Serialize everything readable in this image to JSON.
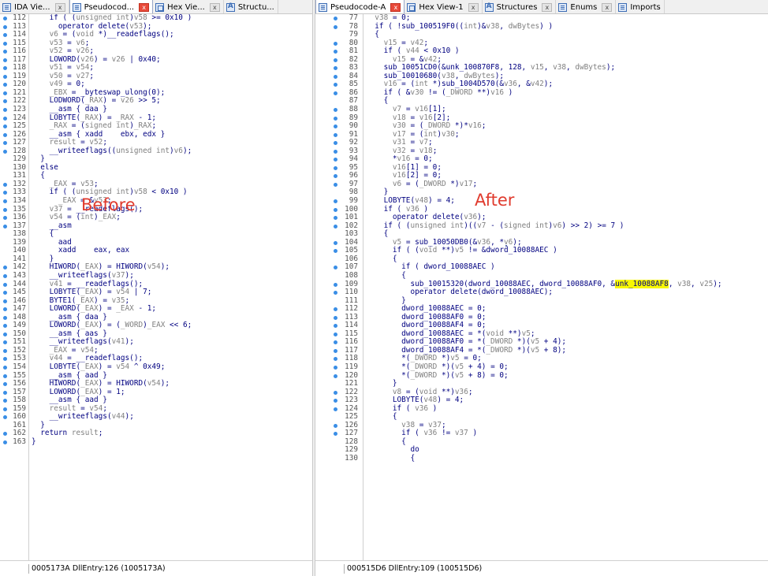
{
  "left": {
    "tabs": [
      {
        "label": "IDA Vie...",
        "icon": "ida-view-icon",
        "close": "x"
      },
      {
        "label": "Pseudocod...",
        "icon": "pseudocode-icon",
        "close": "x"
      },
      {
        "label": "Hex Vie...",
        "icon": "hex-view-icon",
        "close": "x"
      },
      {
        "label": "Structu...",
        "icon": "structures-icon",
        "close": ""
      }
    ],
    "status": "0005173A  DllEntry:126 (1005173A)"
  },
  "right": {
    "tabs": [
      {
        "label": "Pseudocode-A",
        "icon": "pseudocode-icon",
        "close": "x"
      },
      {
        "label": "Hex View-1",
        "icon": "hex-view-icon",
        "close": "x"
      },
      {
        "label": "Structures",
        "icon": "structures-icon",
        "close": "x"
      },
      {
        "label": "Enums",
        "icon": "enums-icon",
        "close": "x"
      },
      {
        "label": "Imports",
        "icon": "imports-icon",
        "close": ""
      }
    ],
    "status": "000515D6  DllEntry:109 (100515D6)"
  },
  "annotations": {
    "before": "Before",
    "after": "After",
    "color": "#e03b2e"
  },
  "highlight_color": "#f8f800",
  "accent_color": "#3a8ee6",
  "left_lines": [
    {
      "n": "112",
      "dot": true,
      "t": "    if ( (unsigned int)v58 >= 0x10 )"
    },
    {
      "n": "113",
      "dot": true,
      "t": "      operator delete(v53);"
    },
    {
      "n": "114",
      "dot": true,
      "t": "    v6 = (void *)__readeflags();"
    },
    {
      "n": "115",
      "dot": true,
      "t": "    v53 = v6;"
    },
    {
      "n": "116",
      "dot": true,
      "t": "    v52 = v26;"
    },
    {
      "n": "117",
      "dot": true,
      "t": "    LOWORD(v26) = v26 | 0x40;"
    },
    {
      "n": "118",
      "dot": true,
      "t": "    v51 = v54;"
    },
    {
      "n": "119",
      "dot": true,
      "t": "    v50 = v27;"
    },
    {
      "n": "120",
      "dot": true,
      "t": "    v49 = 0;"
    },
    {
      "n": "121",
      "dot": true,
      "t": "    _EBX = _byteswap_ulong(0);"
    },
    {
      "n": "122",
      "dot": true,
      "t": "    LODWORD(_RAX) = v26 >> 5;"
    },
    {
      "n": "123",
      "dot": true,
      "t": "    __asm { daa }"
    },
    {
      "n": "124",
      "dot": true,
      "t": "    LOBYTE(_RAX) = _RAX - 1;"
    },
    {
      "n": "125",
      "dot": true,
      "t": "    _RAX = (signed int)_RAX;"
    },
    {
      "n": "126",
      "dot": true,
      "t": "    __asm { xadd    ebx, edx }"
    },
    {
      "n": "127",
      "dot": true,
      "t": "    result = v52;"
    },
    {
      "n": "128",
      "dot": true,
      "t": "    __writeeflags((unsigned int)v6);"
    },
    {
      "n": "129",
      "dot": false,
      "t": "  }"
    },
    {
      "n": "130",
      "dot": false,
      "t": "  else"
    },
    {
      "n": "131",
      "dot": false,
      "t": "  {"
    },
    {
      "n": "132",
      "dot": true,
      "t": "    _EAX = v53;"
    },
    {
      "n": "133",
      "dot": true,
      "t": "    if ( (unsigned int)v58 < 0x10 )"
    },
    {
      "n": "134",
      "dot": true,
      "t": "      _EAX = &v53;"
    },
    {
      "n": "135",
      "dot": true,
      "t": "    v37 = __readeflags();"
    },
    {
      "n": "136",
      "dot": true,
      "t": "    v54 = (int)_EAX;"
    },
    {
      "n": "137",
      "dot": true,
      "t": "    __asm"
    },
    {
      "n": "138",
      "dot": false,
      "t": "    {"
    },
    {
      "n": "139",
      "dot": false,
      "t": "      aad"
    },
    {
      "n": "140",
      "dot": false,
      "t": "      xadd    eax, eax"
    },
    {
      "n": "141",
      "dot": false,
      "t": "    }"
    },
    {
      "n": "142",
      "dot": true,
      "t": "    HIWORD(_EAX) = HIWORD(v54);"
    },
    {
      "n": "143",
      "dot": true,
      "t": "    __writeeflags(v37);"
    },
    {
      "n": "144",
      "dot": true,
      "t": "    v41 = __readeflags();"
    },
    {
      "n": "145",
      "dot": true,
      "t": "    LOBYTE(_EAX) = v54 | 7;"
    },
    {
      "n": "146",
      "dot": true,
      "t": "    BYTE1(_EAX) = v35;"
    },
    {
      "n": "147",
      "dot": true,
      "t": "    LOWORD(_EAX) = _EAX - 1;"
    },
    {
      "n": "148",
      "dot": true,
      "t": "    __asm { daa }"
    },
    {
      "n": "149",
      "dot": true,
      "t": "    LOWORD(_EAX) = (_WORD)_EAX << 6;"
    },
    {
      "n": "150",
      "dot": true,
      "t": "    __asm { aas }"
    },
    {
      "n": "151",
      "dot": true,
      "t": "    __writeeflags(v41);"
    },
    {
      "n": "152",
      "dot": true,
      "t": "    _EAX = v54;"
    },
    {
      "n": "153",
      "dot": true,
      "t": "    v44 = __readeflags();"
    },
    {
      "n": "154",
      "dot": true,
      "t": "    LOBYTE(_EAX) = v54 ^ 0x49;"
    },
    {
      "n": "155",
      "dot": true,
      "t": "    __asm { aad }"
    },
    {
      "n": "156",
      "dot": true,
      "t": "    HIWORD(_EAX) = HIWORD(v54);"
    },
    {
      "n": "157",
      "dot": true,
      "t": "    LOWORD(_EAX) = 1;"
    },
    {
      "n": "158",
      "dot": true,
      "t": "    __asm { aad }"
    },
    {
      "n": "159",
      "dot": true,
      "t": "    result = v54;"
    },
    {
      "n": "160",
      "dot": true,
      "t": "    __writeeflags(v44);"
    },
    {
      "n": "161",
      "dot": false,
      "t": "  }"
    },
    {
      "n": "162",
      "dot": true,
      "t": "  return result;"
    },
    {
      "n": "163",
      "dot": true,
      "t": "}"
    }
  ],
  "right_lines": [
    {
      "n": "77",
      "dot": true,
      "t": "  v38 = 0;"
    },
    {
      "n": "78",
      "dot": true,
      "t": "  if ( !sub_100519F0((int)&v38, dwBytes) )"
    },
    {
      "n": "79",
      "dot": false,
      "t": "  {"
    },
    {
      "n": "80",
      "dot": true,
      "t": "    v15 = v42;"
    },
    {
      "n": "81",
      "dot": true,
      "t": "    if ( v44 < 0x10 )"
    },
    {
      "n": "82",
      "dot": true,
      "t": "      v15 = &v42;"
    },
    {
      "n": "83",
      "dot": true,
      "t": "    sub_10051CD0(&unk_100870F8, 128, v15, v38, dwBytes);"
    },
    {
      "n": "84",
      "dot": true,
      "t": "    sub_10010680(v38, dwBytes);"
    },
    {
      "n": "85",
      "dot": true,
      "t": "    v16 = (int *)sub_1004D570(&v36, &v42);"
    },
    {
      "n": "86",
      "dot": true,
      "t": "    if ( &v30 != (_DWORD **)v16 )"
    },
    {
      "n": "87",
      "dot": false,
      "t": "    {"
    },
    {
      "n": "88",
      "dot": true,
      "t": "      v7 = v16[1];"
    },
    {
      "n": "89",
      "dot": true,
      "t": "      v18 = v16[2];"
    },
    {
      "n": "90",
      "dot": true,
      "t": "      v30 = (_DWORD *)*v16;"
    },
    {
      "n": "91",
      "dot": true,
      "t": "      v17 = (int)v30;"
    },
    {
      "n": "92",
      "dot": true,
      "t": "      v31 = v7;"
    },
    {
      "n": "93",
      "dot": true,
      "t": "      v32 = v18;"
    },
    {
      "n": "94",
      "dot": true,
      "t": "      *v16 = 0;"
    },
    {
      "n": "95",
      "dot": true,
      "t": "      v16[1] = 0;"
    },
    {
      "n": "96",
      "dot": true,
      "t": "      v16[2] = 0;"
    },
    {
      "n": "97",
      "dot": true,
      "t": "      v6 = (_DWORD *)v17;"
    },
    {
      "n": "98",
      "dot": false,
      "t": "    }"
    },
    {
      "n": "99",
      "dot": true,
      "t": "    LOBYTE(v48) = 4;"
    },
    {
      "n": "100",
      "dot": true,
      "t": "    if ( v36 )"
    },
    {
      "n": "101",
      "dot": true,
      "t": "      operator delete(v36);"
    },
    {
      "n": "102",
      "dot": true,
      "t": "    if ( (unsigned int)((v7 - (signed int)v6) >> 2) >= 7 )"
    },
    {
      "n": "103",
      "dot": false,
      "t": "    {"
    },
    {
      "n": "104",
      "dot": true,
      "t": "      v5 = sub_10050DB0(&v36, *v6);"
    },
    {
      "n": "105",
      "dot": true,
      "t": "      if ( (void **)v5 != &dword_10088AEC )"
    },
    {
      "n": "106",
      "dot": false,
      "t": "      {"
    },
    {
      "n": "107",
      "dot": true,
      "t": "        if ( dword_10088AEC )"
    },
    {
      "n": "108",
      "dot": false,
      "t": "        {"
    },
    {
      "n": "109",
      "dot": true,
      "t": "          sub_10015320(dword_10088AEC, dword_10088AF0, &",
      "hl": "unk_10088AF8",
      "t2": ", v38, v25);"
    },
    {
      "n": "110",
      "dot": true,
      "t": "          operator delete(dword_10088AEC);"
    },
    {
      "n": "111",
      "dot": false,
      "t": "        }"
    },
    {
      "n": "112",
      "dot": true,
      "t": "        dword_10088AEC = 0;"
    },
    {
      "n": "113",
      "dot": true,
      "t": "        dword_10088AF0 = 0;"
    },
    {
      "n": "114",
      "dot": true,
      "t": "        dword_10088AF4 = 0;"
    },
    {
      "n": "115",
      "dot": true,
      "t": "        dword_10088AEC = *(void **)v5;"
    },
    {
      "n": "116",
      "dot": true,
      "t": "        dword_10088AF0 = *(_DWORD *)(v5 + 4);"
    },
    {
      "n": "117",
      "dot": true,
      "t": "        dword_10088AF4 = *(_DWORD *)(v5 + 8);"
    },
    {
      "n": "118",
      "dot": true,
      "t": "        *(_DWORD *)v5 = 0;"
    },
    {
      "n": "119",
      "dot": true,
      "t": "        *(_DWORD *)(v5 + 4) = 0;"
    },
    {
      "n": "120",
      "dot": true,
      "t": "        *(_DWORD *)(v5 + 8) = 0;"
    },
    {
      "n": "121",
      "dot": false,
      "t": "      }"
    },
    {
      "n": "122",
      "dot": true,
      "t": "      v8 = (void **)v36;"
    },
    {
      "n": "123",
      "dot": true,
      "t": "      LOBYTE(v48) = 4;"
    },
    {
      "n": "124",
      "dot": true,
      "t": "      if ( v36 )"
    },
    {
      "n": "125",
      "dot": false,
      "t": "      {"
    },
    {
      "n": "126",
      "dot": true,
      "t": "        v38 = v37;"
    },
    {
      "n": "127",
      "dot": true,
      "t": "        if ( v36 != v37 )"
    },
    {
      "n": "128",
      "dot": false,
      "t": "        {"
    },
    {
      "n": "129",
      "dot": false,
      "t": "          do"
    },
    {
      "n": "130",
      "dot": false,
      "t": "          {"
    }
  ]
}
